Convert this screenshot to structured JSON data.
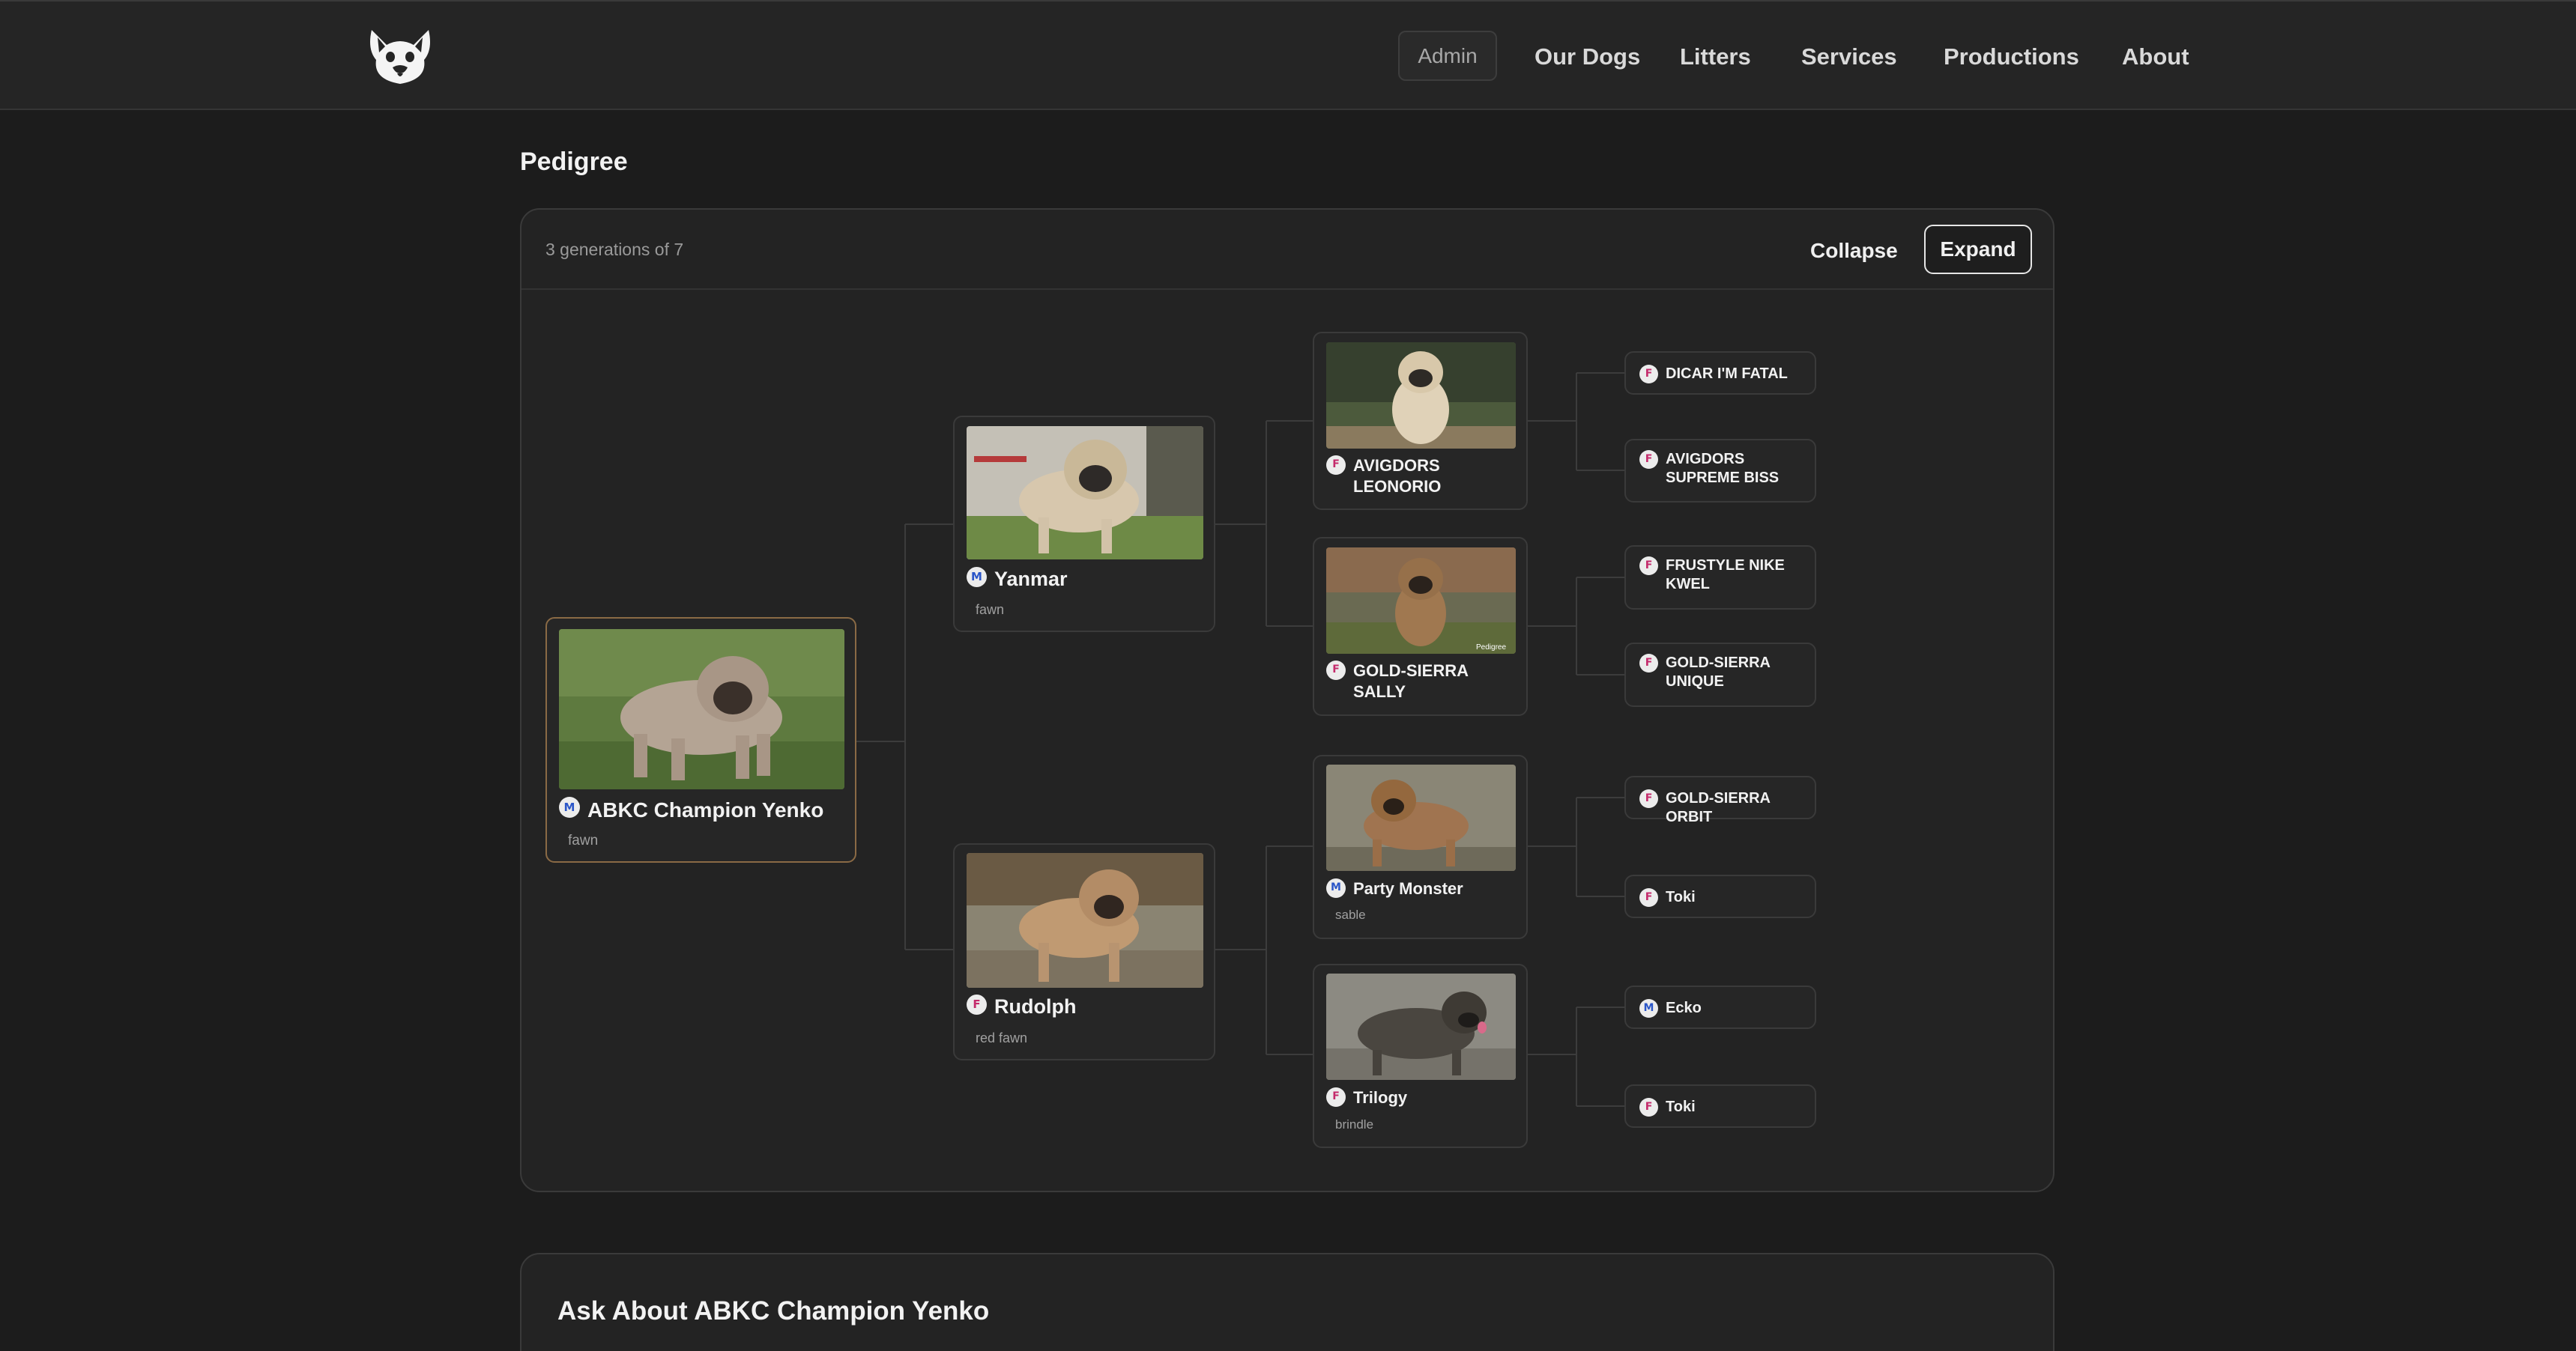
{
  "nav": {
    "admin": "Admin",
    "items": [
      "Our Dogs",
      "Litters",
      "Services",
      "Productions",
      "About"
    ]
  },
  "pedigree": {
    "title": "Pedigree",
    "generations": "3 generations of 7",
    "collapse": "Collapse",
    "expand": "Expand",
    "subject": {
      "name": "ABKC Champion Yenko",
      "sex": "M",
      "color": "fawn"
    },
    "sire": {
      "name": "Yanmar",
      "sex": "M",
      "color": "fawn"
    },
    "dam": {
      "name": "Rudolph",
      "sex": "F",
      "color": "red fawn"
    },
    "gen3": [
      {
        "name": "AVIGDORS LEONORIO",
        "sex": "F",
        "color": ""
      },
      {
        "name": "GOLD-SIERRA SALLY",
        "sex": "F",
        "color": "",
        "watermark": "Pedigree"
      },
      {
        "name": "Party Monster",
        "sex": "M",
        "color": "sable"
      },
      {
        "name": "Trilogy",
        "sex": "F",
        "color": "brindle"
      }
    ],
    "gen4": [
      {
        "name": "DICAR I'M FATAL",
        "sex": "F"
      },
      {
        "name": "AVIGDORS SUPREME BISS",
        "sex": "F"
      },
      {
        "name": "FRUSTYLE NIKE KWEL",
        "sex": "F"
      },
      {
        "name": "GOLD-SIERRA UNIQUE",
        "sex": "F"
      },
      {
        "name": "GOLD-SIERRA ORBIT",
        "sex": "F"
      },
      {
        "name": "Toki",
        "sex": "F"
      },
      {
        "name": "Ecko",
        "sex": "M"
      },
      {
        "name": "Toki",
        "sex": "F"
      }
    ]
  },
  "ask": {
    "title": "Ask About ABKC Champion Yenko"
  },
  "colors": {
    "background": "#1c1c1c",
    "card": "#232323",
    "accent_border": "#8a6a45",
    "male": "#2b56c8",
    "female": "#c42a6b"
  }
}
